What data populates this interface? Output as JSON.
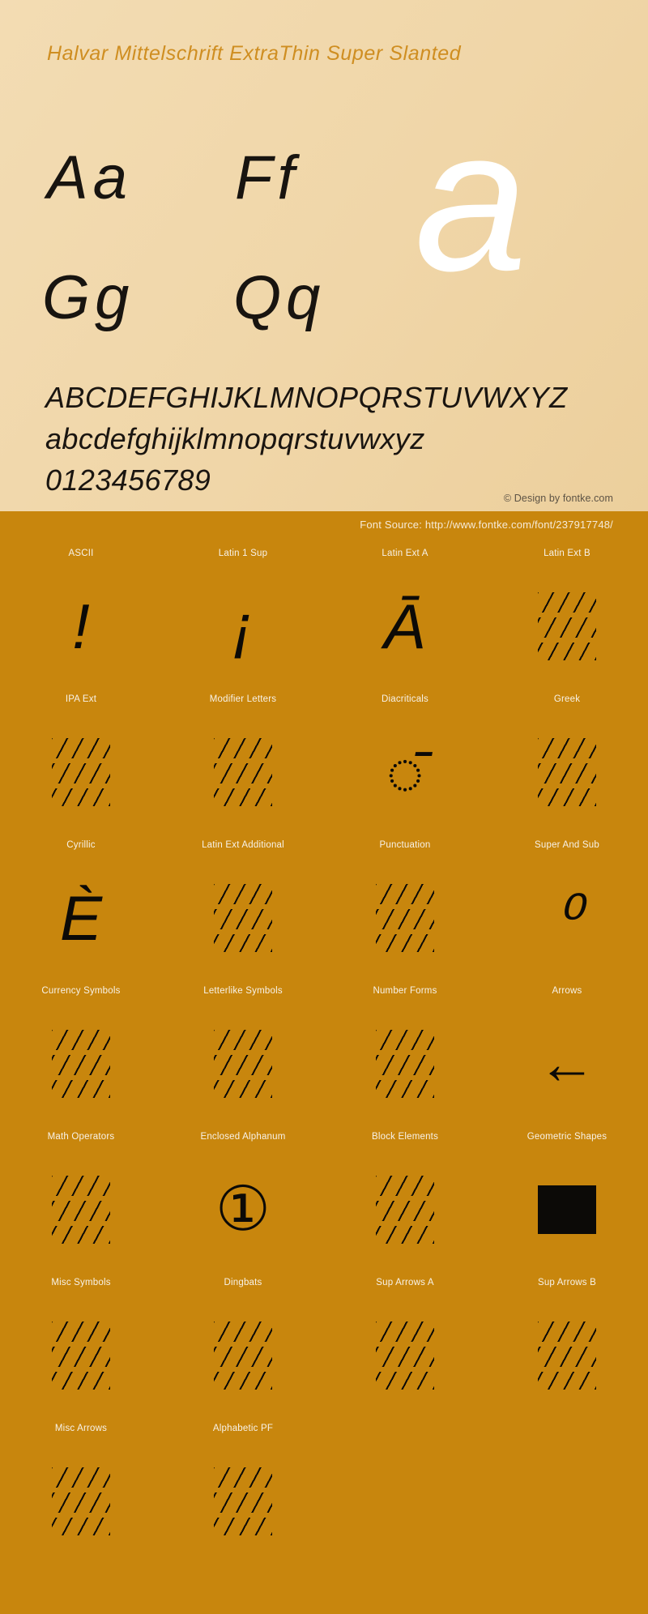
{
  "specimen": {
    "title": "Halvar Mittelschrift ExtraThin Super Slanted",
    "pairs": [
      {
        "name": "aa",
        "text": "Aa"
      },
      {
        "name": "ff",
        "text": "Ff"
      },
      {
        "name": "gg",
        "text": "Gg"
      },
      {
        "name": "qq",
        "text": "Qq"
      }
    ],
    "big_glyph": "a",
    "uppercase": "ABCDEFGHIJKLMNOPQRSTUVWXYZ",
    "lowercase": "abcdefghijklmnopqrstuvwxyz",
    "digits": "0123456789",
    "copyright": "© Design by fontke.com"
  },
  "source_bar": {
    "text": "Font Source: http://www.fontke.com/font/237917748/"
  },
  "colors": {
    "panel_background": "#f1d8ac",
    "band_background": "#c8860d",
    "title_accent": "#cf8e21",
    "glyph_ink": "#0c0a07",
    "big_glyph": "#ffffff",
    "label_text": "#f8f2e8",
    "copyright_text": "#5d5345"
  },
  "unicode_blocks": [
    [
      {
        "label": "ASCII",
        "glyph": "!",
        "kind": "glyph"
      },
      {
        "label": "Latin 1 Sup",
        "glyph": "¡",
        "kind": "glyph"
      },
      {
        "label": "Latin Ext A",
        "glyph": "Ā",
        "kind": "glyph"
      },
      {
        "label": "Latin Ext B",
        "glyph": "",
        "kind": "hatch"
      }
    ],
    [
      {
        "label": "IPA Ext",
        "glyph": "",
        "kind": "hatch"
      },
      {
        "label": "Modifier Letters",
        "glyph": "",
        "kind": "hatch"
      },
      {
        "label": "Diacriticals",
        "glyph": "◌̄",
        "kind": "glyph"
      },
      {
        "label": "Greek",
        "glyph": "",
        "kind": "hatch"
      }
    ],
    [
      {
        "label": "Cyrillic",
        "glyph": "Ѐ",
        "kind": "glyph"
      },
      {
        "label": "Latin Ext Additional",
        "glyph": "",
        "kind": "hatch"
      },
      {
        "label": "Punctuation",
        "glyph": "",
        "kind": "hatch"
      },
      {
        "label": "Super And Sub",
        "glyph": "⁰",
        "kind": "glyph"
      }
    ],
    [
      {
        "label": "Currency Symbols",
        "glyph": "",
        "kind": "hatch"
      },
      {
        "label": "Letterlike Symbols",
        "glyph": "",
        "kind": "hatch"
      },
      {
        "label": "Number Forms",
        "glyph": "",
        "kind": "hatch"
      },
      {
        "label": "Arrows",
        "glyph": "←",
        "kind": "arrow"
      }
    ],
    [
      {
        "label": "Math Operators",
        "glyph": "",
        "kind": "hatch"
      },
      {
        "label": "Enclosed Alphanum",
        "glyph": "①",
        "kind": "circled"
      },
      {
        "label": "Block Elements",
        "glyph": "",
        "kind": "hatch"
      },
      {
        "label": "Geometric Shapes",
        "glyph": "■",
        "kind": "solid"
      }
    ],
    [
      {
        "label": "Misc Symbols",
        "glyph": "",
        "kind": "hatch"
      },
      {
        "label": "Dingbats",
        "glyph": "",
        "kind": "hatch"
      },
      {
        "label": "Sup Arrows A",
        "glyph": "",
        "kind": "hatch"
      },
      {
        "label": "Sup Arrows B",
        "glyph": "",
        "kind": "hatch"
      }
    ],
    [
      {
        "label": "Misc Arrows",
        "glyph": "",
        "kind": "hatch"
      },
      {
        "label": "Alphabetic PF",
        "glyph": "",
        "kind": "hatch"
      },
      {
        "label": "",
        "glyph": "",
        "kind": "empty"
      },
      {
        "label": "",
        "glyph": "",
        "kind": "empty"
      }
    ]
  ]
}
